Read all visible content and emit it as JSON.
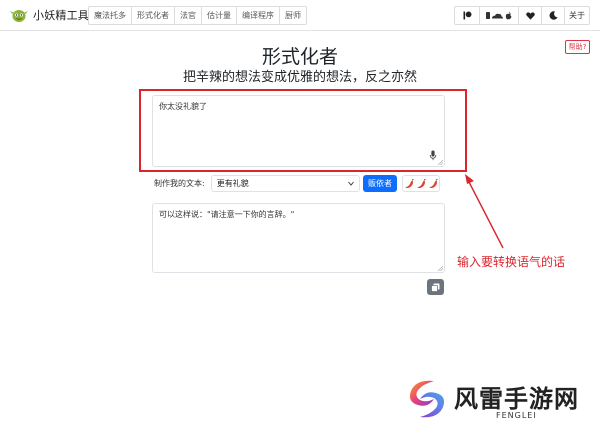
{
  "navbar": {
    "brand": "小妖精工具",
    "items": [
      {
        "label": "魔法托多"
      },
      {
        "label": "形式化者"
      },
      {
        "label": "法官"
      },
      {
        "label": "估计量"
      },
      {
        "label": "编译程序"
      },
      {
        "label": "厨师"
      }
    ],
    "right_icons": [
      "flag-icon",
      "cloud-apple-icon",
      "heart-icon",
      "moon-icon"
    ],
    "about_label": "关于"
  },
  "help_label": "帮助?",
  "title": "形式化者",
  "subtitle": "把辛辣的想法变成优雅的想法，反之亦然",
  "input": {
    "value": "你太没礼貌了"
  },
  "options": {
    "label": "制作我的文本:",
    "selected": "更有礼貌",
    "make_button": "贩依者",
    "spice_level_icons": [
      "pepper-icon",
      "pepper-icon",
      "pepper-icon"
    ]
  },
  "output": {
    "value": "可以这样说：\"请注意一下你的言辞。\""
  },
  "annotation": {
    "text": "输入要转换语气的话",
    "color": "#d7272d"
  },
  "watermark": {
    "title": "风雷手游网",
    "subtitle": "FENGLEI"
  },
  "colors": {
    "primary": "#0d6efd",
    "danger": "#dc3545",
    "secondary": "#6c757d"
  }
}
